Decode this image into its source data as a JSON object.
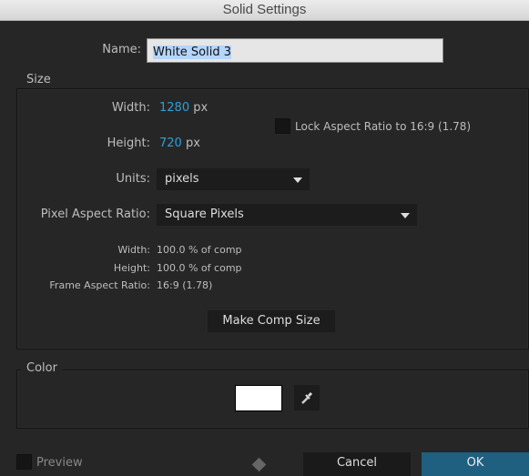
{
  "window": {
    "title": "Solid Settings"
  },
  "name": {
    "label": "Name:",
    "value": "White Solid 3"
  },
  "size": {
    "group_label": "Size",
    "width_label": "Width:",
    "width_value": "1280",
    "width_unit": "px",
    "height_label": "Height:",
    "height_value": "720",
    "height_unit": "px",
    "lock_label": "Lock Aspect Ratio to 16:9 (1.78)",
    "lock_checked": false,
    "units_label": "Units:",
    "units_value": "pixels",
    "par_label": "Pixel Aspect Ratio:",
    "par_value": "Square Pixels",
    "info": [
      {
        "label": "Width:",
        "value": "100.0 % of comp"
      },
      {
        "label": "Height:",
        "value": "100.0 % of comp"
      },
      {
        "label": "Frame Aspect Ratio:",
        "value": "16:9 (1.78)"
      }
    ],
    "make_comp_size": "Make Comp Size"
  },
  "color": {
    "group_label": "Color",
    "swatch": "#ffffff",
    "eyedropper_icon": "eyedropper-icon"
  },
  "footer": {
    "preview_label": "Preview",
    "cancel": "Cancel",
    "ok": "OK",
    "ok_color": "#1f5f80"
  }
}
